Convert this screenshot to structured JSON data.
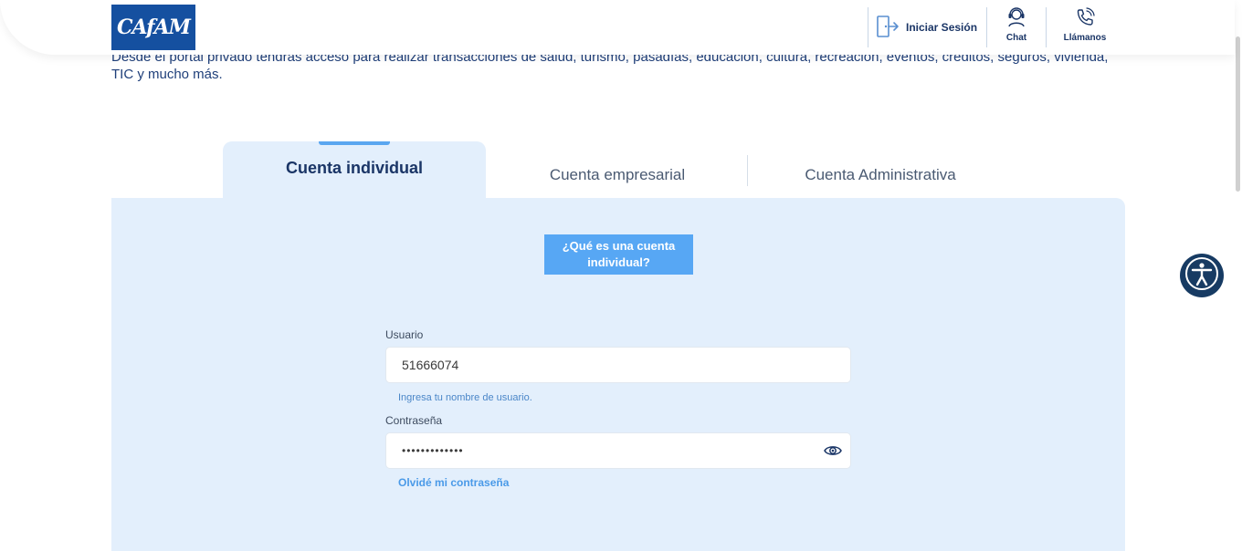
{
  "header": {
    "logo_text": "CAfAM",
    "login_label": "Iniciar Sesión",
    "chat_label": "Chat",
    "call_label": "Llámanos"
  },
  "intro": {
    "text": "Desde el portal privado tendrás acceso para realizar transacciones de salud, turismo, pasadías, educación, cultura, recreación, eventos, créditos, seguros, vivienda, TIC y mucho más."
  },
  "tabs": [
    {
      "label": "Cuenta individual",
      "active": true
    },
    {
      "label": "Cuenta empresarial",
      "active": false
    },
    {
      "label": "Cuenta Administrativa",
      "active": false
    }
  ],
  "panel": {
    "info_button": "¿Qué es una cuenta individual?",
    "username": {
      "label": "Usuario",
      "value": "51666074",
      "help": "Ingresa tu nombre de usuario."
    },
    "password": {
      "label": "Contraseña",
      "value": "•••••••••••••",
      "toggle_icon": "eye-icon"
    },
    "forgot_link": "Olvidé mi contraseña"
  },
  "icons": {
    "login": "login-door-icon",
    "chat": "headset-agent-icon",
    "call": "phone-icon",
    "accessibility": "accessibility-icon"
  },
  "colors": {
    "brand_blue": "#1550a0",
    "panel_bg": "#e3effc",
    "accent_blue": "#57a7f4",
    "text_dark": "#1a3566",
    "accessibility_bg": "#173b63"
  }
}
